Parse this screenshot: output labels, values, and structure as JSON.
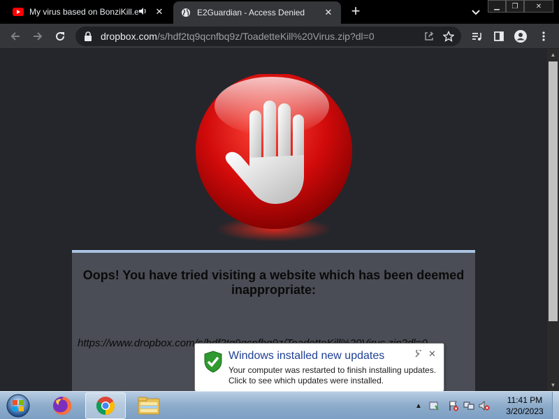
{
  "browser": {
    "tabs": [
      {
        "title": "My virus based on BonziKill.e",
        "favicon": "youtube-icon",
        "audio": "speaker-icon",
        "active": false
      },
      {
        "title": "E2Guardian - Access Denied",
        "favicon": "globe-icon",
        "active": true
      }
    ],
    "url_host": "dropbox.com",
    "url_path": "/s/hdf2tq9qcnfbq9z/ToadetteKill%20Virus.zip?dl=0"
  },
  "page": {
    "message": "Oops! You have tried visiting a website which has been deemed inappropriate:",
    "blocked_url": "https://www.dropbox.com/s/hdf2tq9qcnfbq9z/ToadetteKill%20Virus.zip?dl=0"
  },
  "notification": {
    "title": "Windows installed new updates",
    "line1": "Your computer was restarted to finish installing updates.",
    "line2": "Click to see which updates were installed."
  },
  "taskbar": {
    "apps": [
      "firefox-icon",
      "chrome-icon",
      "explorer-icon"
    ],
    "time": "11:41 PM",
    "date": "3/20/2023"
  },
  "colors": {
    "stop_red": "#d10a0a",
    "notification_title": "#1e3f94",
    "box_border": "#a9c4e2"
  }
}
